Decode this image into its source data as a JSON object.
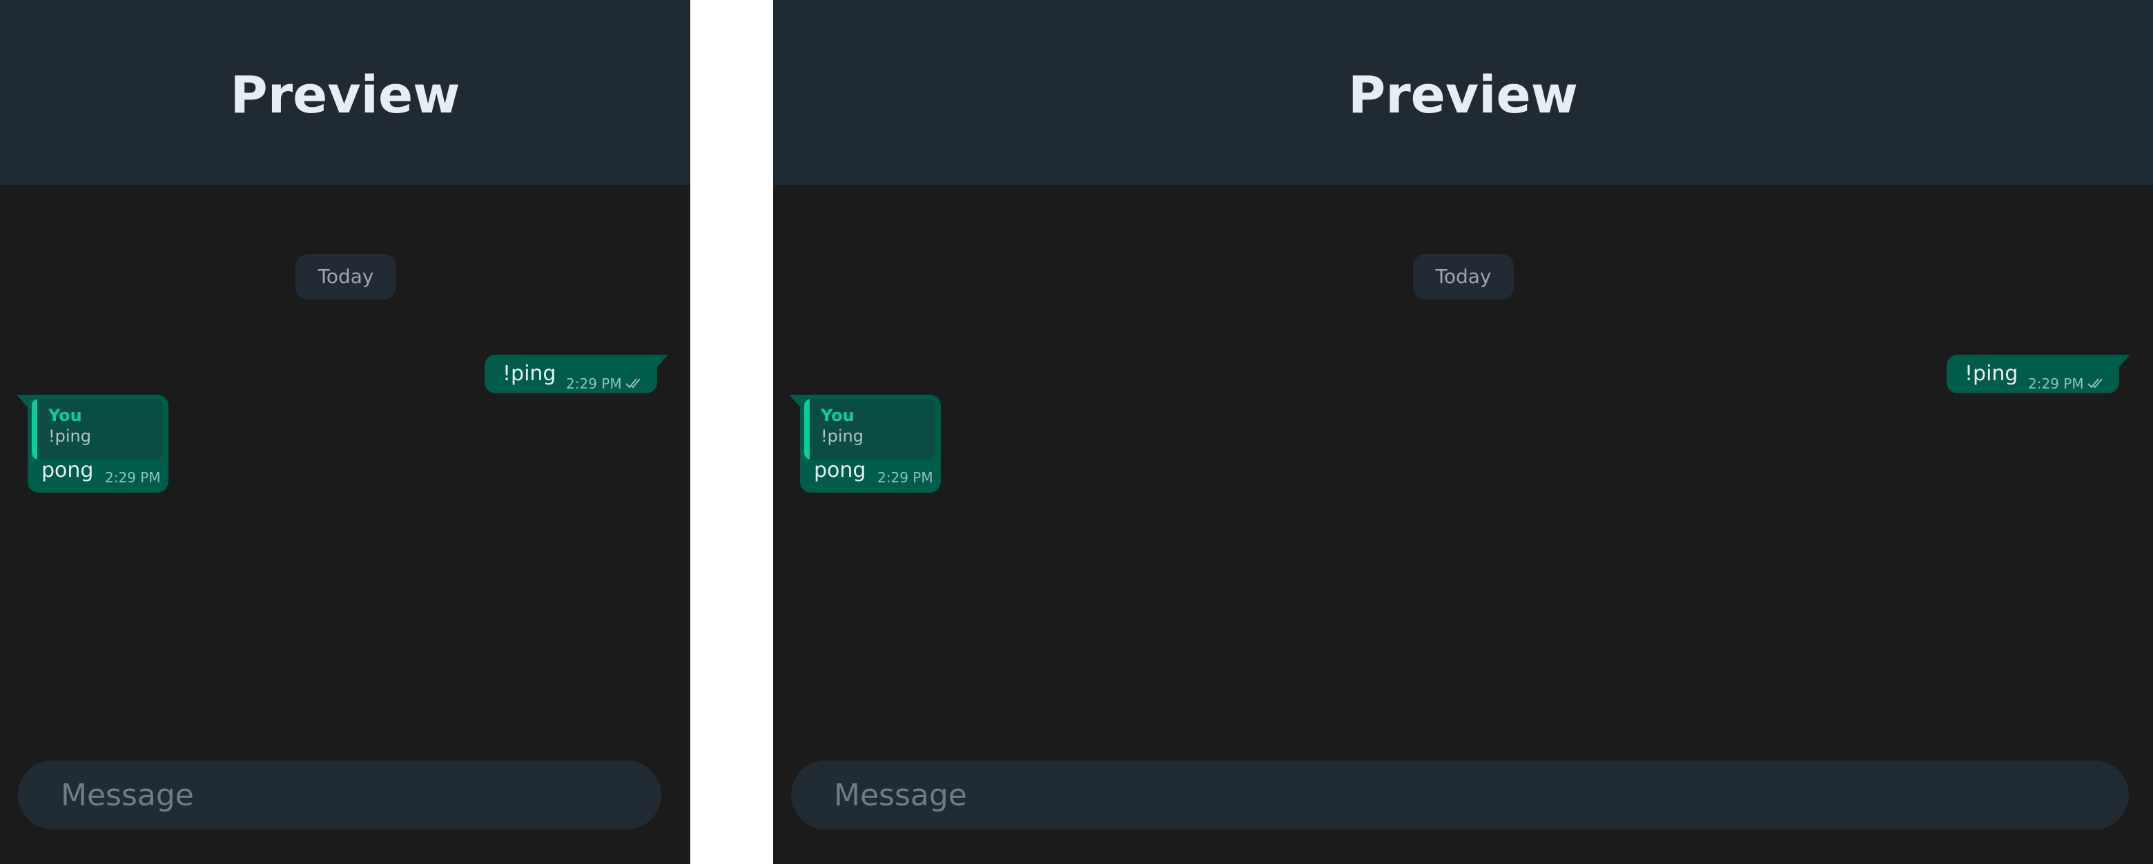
{
  "panels": [
    {
      "header_title": "Preview",
      "date_label": "Today",
      "outgoing": {
        "text": "!ping",
        "time": "2:29 PM",
        "status_icon": "double-check-icon"
      },
      "incoming": {
        "quote_sender": "You",
        "quote_text": "!ping",
        "text": "pong",
        "time": "2:29 PM"
      },
      "composer": {
        "placeholder": "Message"
      }
    },
    {
      "header_title": "Preview",
      "date_label": "Today",
      "outgoing": {
        "text": "!ping",
        "time": "2:29 PM",
        "status_icon": "double-check-icon"
      },
      "incoming": {
        "quote_sender": "You",
        "quote_text": "!ping",
        "text": "pong",
        "time": "2:29 PM"
      },
      "composer": {
        "placeholder": "Message"
      }
    }
  ],
  "colors": {
    "header_bg": "#202a32",
    "chat_bg": "#1b1b1b",
    "bubble": "#005c4b",
    "quote_accent": "#06cf9c",
    "composer_bg": "#212b33"
  }
}
